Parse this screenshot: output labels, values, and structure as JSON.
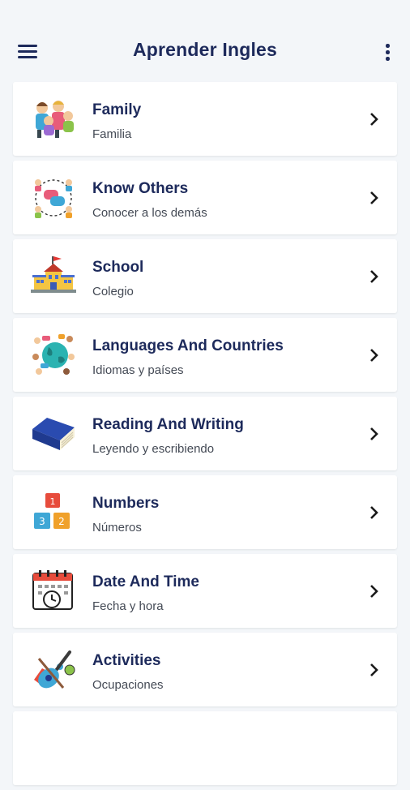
{
  "header": {
    "title": "Aprender Ingles",
    "menu_icon": "hamburger-menu-icon",
    "more_icon": "more-vert-icon"
  },
  "topics": [
    {
      "title": "Family",
      "subtitle": "Familia",
      "icon": "family-icon"
    },
    {
      "title": "Know Others",
      "subtitle": "Conocer a los demás",
      "icon": "people-chat-icon"
    },
    {
      "title": "School",
      "subtitle": "Colegio",
      "icon": "school-building-icon"
    },
    {
      "title": "Languages And Countries",
      "subtitle": "Idiomas y países",
      "icon": "globe-people-icon"
    },
    {
      "title": "Reading And Writing",
      "subtitle": "Leyendo y escribiendo",
      "icon": "book-icon"
    },
    {
      "title": "Numbers",
      "subtitle": "Números",
      "icon": "number-blocks-icon"
    },
    {
      "title": "Date And Time",
      "subtitle": "Fecha y hora",
      "icon": "calendar-clock-icon"
    },
    {
      "title": "Activities",
      "subtitle": "Ocupaciones",
      "icon": "guitar-activities-icon"
    }
  ],
  "colors": {
    "primary_text": "#1d2a5b",
    "background": "#f3f6f9",
    "card": "#ffffff"
  }
}
